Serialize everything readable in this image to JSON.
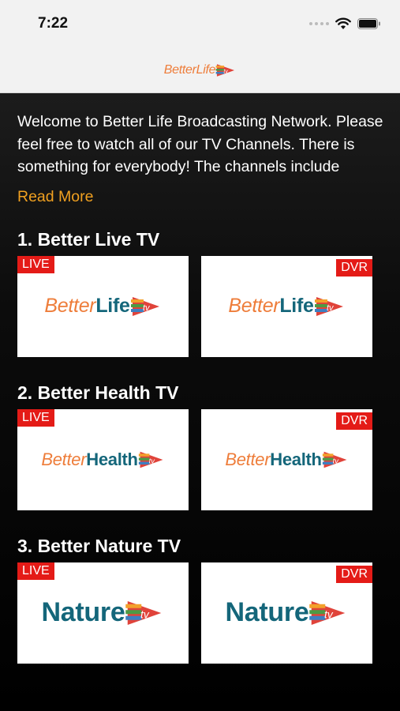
{
  "status": {
    "time": "7:22"
  },
  "header": {
    "logo_part1": "Better",
    "logo_part2": "Life"
  },
  "intro": {
    "text": "Welcome to Better Life Broadcasting Network. Please feel free to watch all of our TV Channels. There is something for everybody! The channels include",
    "read_more": "Read More"
  },
  "sections": [
    {
      "title": "1. Better Live TV",
      "logo_part1": "Better",
      "logo_part2": "Life",
      "live_label": "LIVE",
      "dvr_label": "DVR"
    },
    {
      "title": "2. Better Health TV",
      "logo_part1": "Better",
      "logo_part2": "Health",
      "live_label": "LIVE",
      "dvr_label": "DVR"
    },
    {
      "title": "3. Better Nature TV",
      "logo_part1": "",
      "logo_part2": "Nature",
      "live_label": "LIVE",
      "dvr_label": "DVR"
    }
  ],
  "colors": {
    "accent": "#f0a020",
    "badge": "#e41b17",
    "logo_orange": "#ee7d3a",
    "logo_teal": "#14667a"
  }
}
